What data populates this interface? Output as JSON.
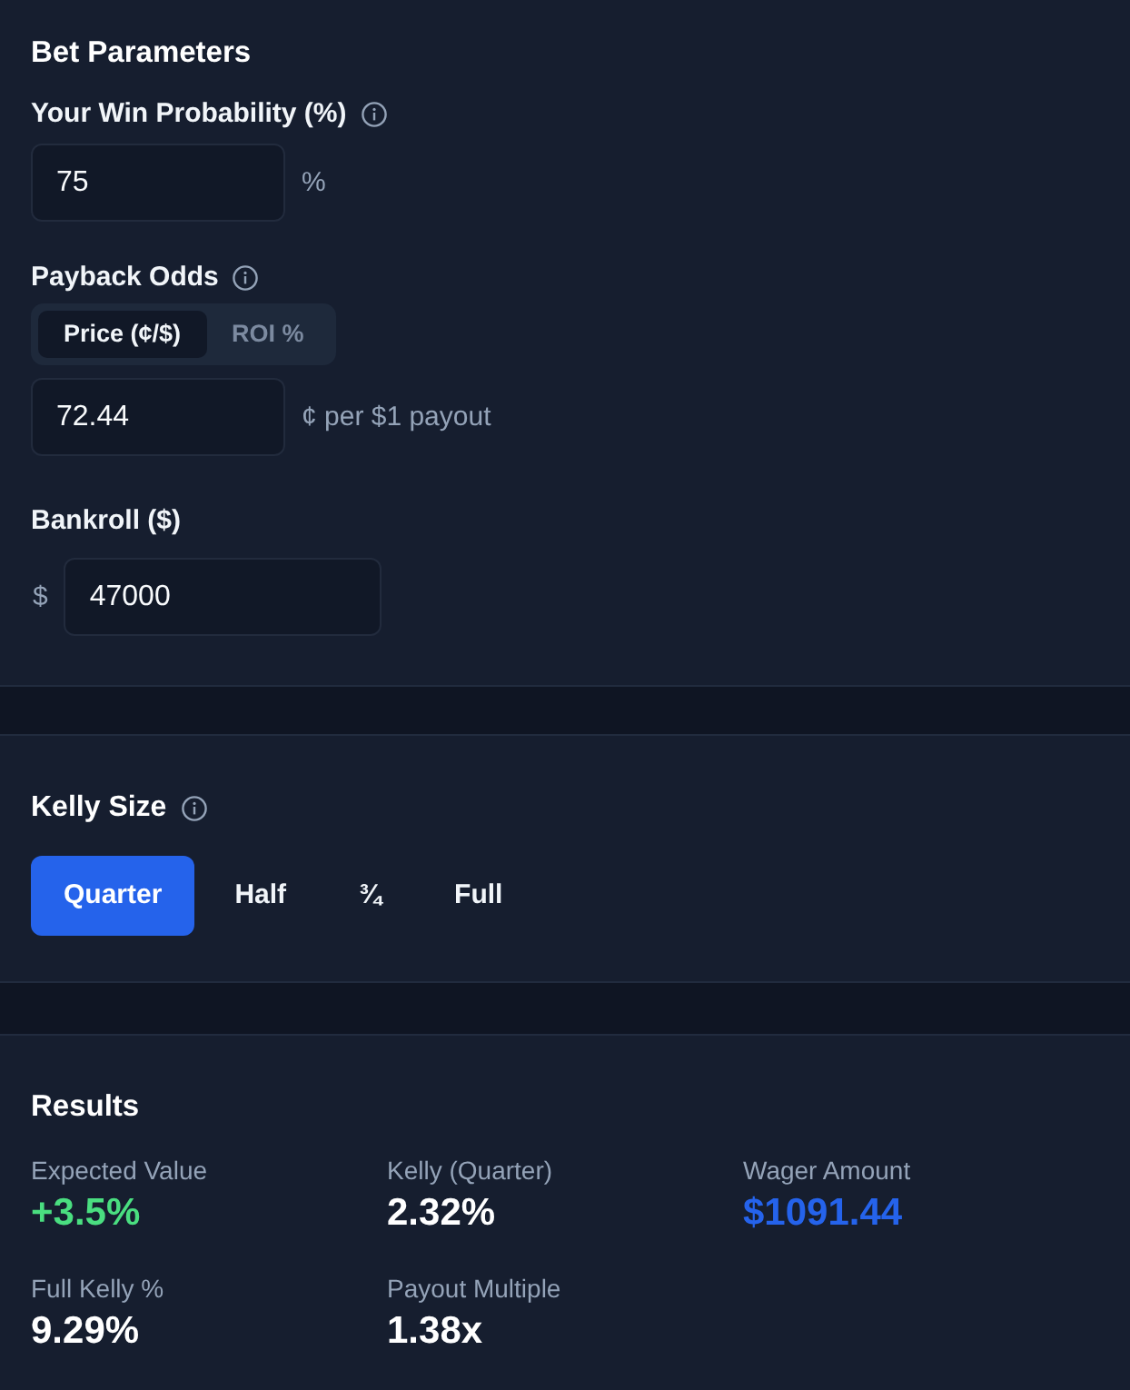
{
  "bet_parameters": {
    "title": "Bet Parameters",
    "win_probability": {
      "label": "Your Win Probability (%)",
      "info_icon": true,
      "value": "75",
      "suffix": "%"
    },
    "payback_odds": {
      "label": "Payback Odds",
      "info_icon": true,
      "modes": [
        {
          "label": "Price (¢/$)",
          "selected": true
        },
        {
          "label": "ROI %",
          "selected": false
        }
      ],
      "value": "72.44",
      "suffix": "¢ per $1 payout"
    },
    "bankroll": {
      "label": "Bankroll ($)",
      "info_icon": false,
      "prefix": "$",
      "value": "47000"
    }
  },
  "kelly_size": {
    "title": "Kelly Size",
    "info_icon": true,
    "options": [
      {
        "label": "Quarter",
        "selected": true
      },
      {
        "label": "Half",
        "selected": false
      },
      {
        "label": "¾",
        "selected": false
      },
      {
        "label": "Full",
        "selected": false
      }
    ]
  },
  "results": {
    "title": "Results",
    "metrics": [
      {
        "label": "Expected Value",
        "value": "+3.5%",
        "color": "#4ade80"
      },
      {
        "label": "Kelly (Quarter)",
        "value": "2.32%",
        "color": "#ffffff"
      },
      {
        "label": "Wager Amount",
        "value": "$1091.44",
        "color": "#2563eb"
      },
      {
        "label": "Full Kelly %",
        "value": "9.29%",
        "color": "#ffffff"
      },
      {
        "label": "Payout Multiple",
        "value": "1.38x",
        "color": "#ffffff"
      }
    ]
  }
}
